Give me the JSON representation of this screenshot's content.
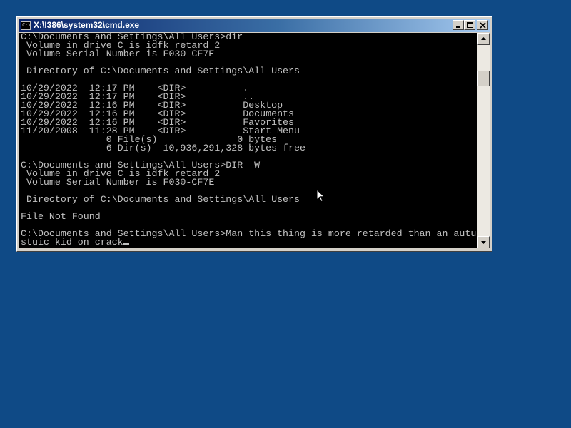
{
  "window": {
    "title": "X:\\I386\\system32\\cmd.exe",
    "icon": "cmd-icon",
    "icon_glyph": "C:\\",
    "buttons": [
      "minimize-icon",
      "maximize-icon",
      "close-icon"
    ]
  },
  "console": {
    "lines": [
      "C:\\Documents and Settings\\All Users>dir",
      " Volume in drive C is idfk retard 2",
      " Volume Serial Number is F030-CF7E",
      "",
      " Directory of C:\\Documents and Settings\\All Users",
      "",
      "10/29/2022  12:17 PM    <DIR>          .",
      "10/29/2022  12:17 PM    <DIR>          ..",
      "10/29/2022  12:16 PM    <DIR>          Desktop",
      "10/29/2022  12:16 PM    <DIR>          Documents",
      "10/29/2022  12:16 PM    <DIR>          Favorites",
      "11/20/2008  11:28 PM    <DIR>          Start Menu",
      "               0 File(s)              0 bytes",
      "               6 Dir(s)  10,936,291,328 bytes free",
      "",
      "C:\\Documents and Settings\\All Users>DIR -W",
      " Volume in drive C is idfk retard 2",
      " Volume Serial Number is F030-CF7E",
      "",
      " Directory of C:\\Documents and Settings\\All Users",
      "",
      "File Not Found",
      "",
      "C:\\Documents and Settings\\All Users>Man this thing is more retarded than an autu"
    ],
    "input_line": "stuic kid on crack"
  },
  "colors": {
    "desktop": "#0f4a86",
    "console_bg": "#000000",
    "console_fg": "#c0c0c0",
    "titlebar_start": "#0a246a",
    "titlebar_end": "#a6caf0"
  }
}
